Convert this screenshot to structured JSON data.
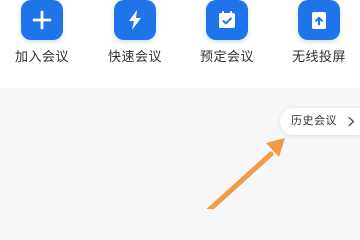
{
  "quick_actions": [
    {
      "label": "加入会议",
      "icon": "plus-icon"
    },
    {
      "label": "快速会议",
      "icon": "lightning-icon"
    },
    {
      "label": "预定会议",
      "icon": "calendar-check-icon"
    },
    {
      "label": "无线投屏",
      "icon": "screen-cast-icon"
    }
  ],
  "history": {
    "label": "历史会议",
    "icon": "chevron-right-icon"
  },
  "annotation": {
    "icon": "annotation-arrow-icon"
  },
  "colors": {
    "accent": "#1f74ea",
    "page_background": "#f6f7f9",
    "panel_background": "#ffffff",
    "annotation_arrow": "#f39a45"
  }
}
